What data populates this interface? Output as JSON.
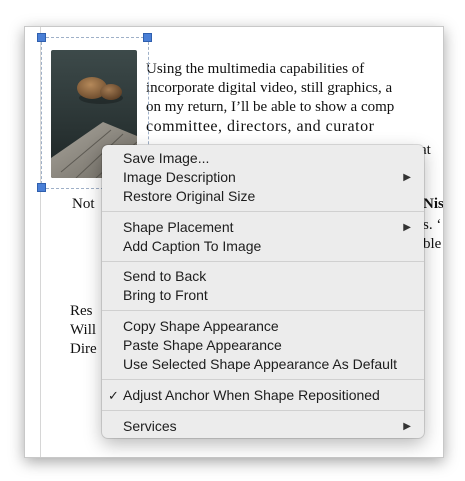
{
  "document": {
    "paragraph_lines": [
      "Using the multimedia capabilities of",
      "incorporate digital video, still graphics, a",
      "on my return, I’ll be able to show a comp",
      "committee, directors, and curator",
      "at"
    ],
    "note_left": "Not",
    "note_right_bold": "Nis",
    "note_right_lines": [
      "s. ‘",
      "ble"
    ],
    "signature_lines": [
      "Res",
      "Will",
      "Dire"
    ]
  },
  "context_menu": {
    "items": [
      {
        "label": "Save Image...",
        "submenu": false
      },
      {
        "label": "Image Description",
        "submenu": true
      },
      {
        "label": "Restore Original Size",
        "submenu": false
      },
      {
        "label": "Shape Placement",
        "submenu": true
      },
      {
        "label": "Add Caption To Image",
        "submenu": false
      },
      {
        "label": "Send to Back",
        "submenu": false
      },
      {
        "label": "Bring to Front",
        "submenu": false
      },
      {
        "label": "Copy Shape Appearance",
        "submenu": false
      },
      {
        "label": "Paste Shape Appearance",
        "submenu": false
      },
      {
        "label": "Use Selected Shape Appearance As Default",
        "submenu": false
      },
      {
        "label": "Adjust Anchor When Shape Repositioned",
        "submenu": false,
        "checked": true,
        "check_mark": "✓"
      },
      {
        "label": "Services",
        "submenu": true
      }
    ],
    "submenu_arrow": "▶"
  }
}
